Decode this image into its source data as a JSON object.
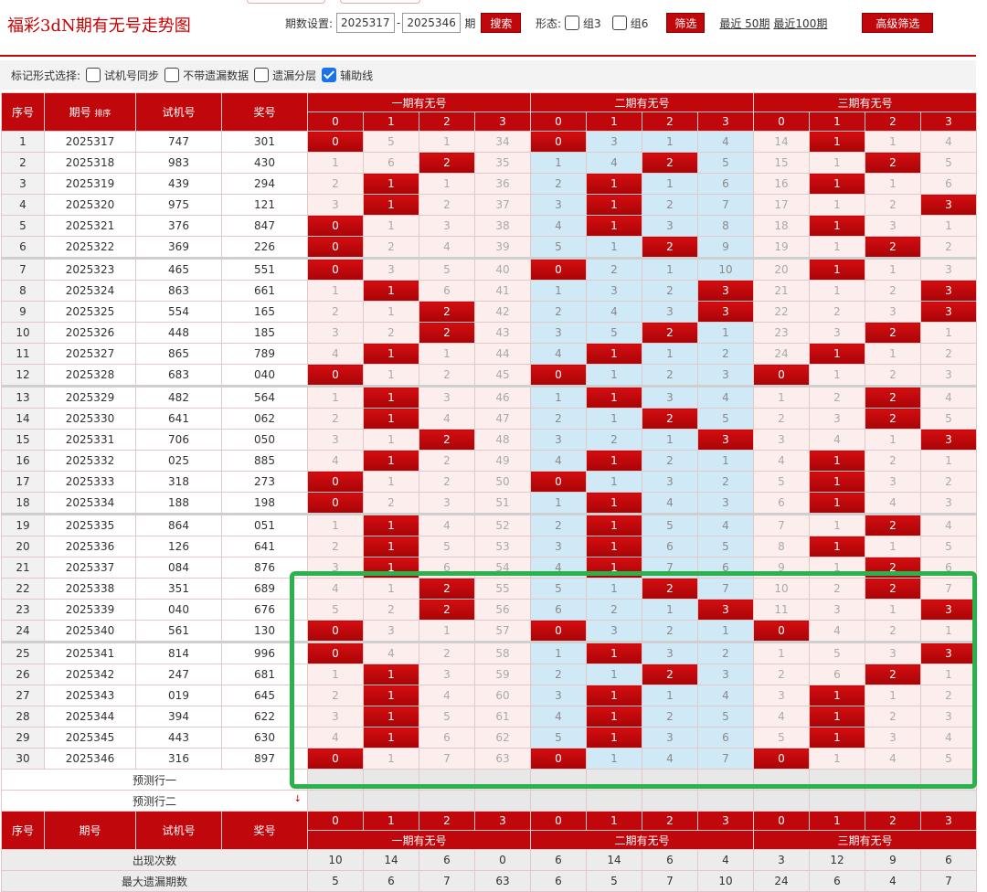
{
  "header": {
    "title": "福彩3dN期有无号走势图",
    "period_label": "期数设置:",
    "period_from": "2025317",
    "period_dash": "-",
    "period_to": "2025346",
    "period_unit": "期",
    "search": "搜索",
    "form_label": "形态:",
    "group3": "组3",
    "group6": "组6",
    "filter": "筛选",
    "recent50": "最近 50期",
    "recent100": "最近100期",
    "advanced": "高级筛选"
  },
  "options": {
    "label": "标记形式选择:",
    "items": [
      {
        "label": "试机号同步",
        "checked": false
      },
      {
        "label": "不带遗漏数据",
        "checked": false
      },
      {
        "label": "遗漏分层",
        "checked": false
      },
      {
        "label": "辅助线",
        "checked": true
      }
    ]
  },
  "table": {
    "head": {
      "seq": "序号",
      "issue": "期号",
      "sort": "排序",
      "test": "试机号",
      "prize": "奖号",
      "groups": [
        "一期有无号",
        "二期有无号",
        "三期有无号"
      ],
      "digits": [
        "0",
        "1",
        "2",
        "3"
      ]
    },
    "rows": [
      {
        "seq": "1",
        "issue": "2025317",
        "test": "747",
        "prize": "301",
        "g1": [
          "0",
          "5",
          "1",
          "34"
        ],
        "g2": [
          "0",
          "3",
          "1",
          "4"
        ],
        "g3": [
          "14",
          "1",
          "1",
          "4"
        ],
        "h1": 0,
        "h2": 0,
        "h3": 1
      },
      {
        "seq": "2",
        "issue": "2025318",
        "test": "983",
        "prize": "430",
        "g1": [
          "1",
          "6",
          "2",
          "35"
        ],
        "g2": [
          "1",
          "4",
          "2",
          "5"
        ],
        "g3": [
          "15",
          "1",
          "2",
          "5"
        ],
        "h1": 2,
        "h2": 2,
        "h3": 2
      },
      {
        "seq": "3",
        "issue": "2025319",
        "test": "439",
        "prize": "294",
        "g1": [
          "2",
          "1",
          "1",
          "36"
        ],
        "g2": [
          "2",
          "1",
          "1",
          "6"
        ],
        "g3": [
          "16",
          "1",
          "1",
          "6"
        ],
        "h1": 1,
        "h2": 1,
        "h3": 1
      },
      {
        "seq": "4",
        "issue": "2025320",
        "test": "975",
        "prize": "121",
        "g1": [
          "3",
          "1",
          "2",
          "37"
        ],
        "g2": [
          "3",
          "1",
          "2",
          "7"
        ],
        "g3": [
          "17",
          "1",
          "2",
          "3"
        ],
        "h1": 1,
        "h2": 1,
        "h3": 3
      },
      {
        "seq": "5",
        "issue": "2025321",
        "test": "376",
        "prize": "847",
        "g1": [
          "0",
          "1",
          "3",
          "38"
        ],
        "g2": [
          "4",
          "1",
          "3",
          "8"
        ],
        "g3": [
          "18",
          "1",
          "3",
          "1"
        ],
        "h1": 0,
        "h2": 1,
        "h3": 1
      },
      {
        "seq": "6",
        "issue": "2025322",
        "test": "369",
        "prize": "226",
        "g1": [
          "0",
          "2",
          "4",
          "39"
        ],
        "g2": [
          "5",
          "1",
          "2",
          "9"
        ],
        "g3": [
          "19",
          "1",
          "2",
          "2"
        ],
        "h1": 0,
        "h2": 2,
        "h3": 2
      },
      {
        "seq": "7",
        "issue": "2025323",
        "test": "465",
        "prize": "551",
        "g1": [
          "0",
          "3",
          "5",
          "40"
        ],
        "g2": [
          "0",
          "2",
          "1",
          "10"
        ],
        "g3": [
          "20",
          "1",
          "1",
          "3"
        ],
        "h1": 0,
        "h2": 0,
        "h3": 1
      },
      {
        "seq": "8",
        "issue": "2025324",
        "test": "863",
        "prize": "661",
        "g1": [
          "1",
          "1",
          "6",
          "41"
        ],
        "g2": [
          "1",
          "3",
          "2",
          "3"
        ],
        "g3": [
          "21",
          "1",
          "2",
          "3"
        ],
        "h1": 1,
        "h2": 3,
        "h3": 3
      },
      {
        "seq": "9",
        "issue": "2025325",
        "test": "554",
        "prize": "165",
        "g1": [
          "2",
          "1",
          "2",
          "42"
        ],
        "g2": [
          "2",
          "4",
          "3",
          "3"
        ],
        "g3": [
          "22",
          "2",
          "3",
          "3"
        ],
        "h1": 2,
        "h2": 3,
        "h3": 3
      },
      {
        "seq": "10",
        "issue": "2025326",
        "test": "448",
        "prize": "185",
        "g1": [
          "3",
          "2",
          "2",
          "43"
        ],
        "g2": [
          "3",
          "5",
          "2",
          "1"
        ],
        "g3": [
          "23",
          "3",
          "2",
          "1"
        ],
        "h1": 2,
        "h2": 2,
        "h3": 2
      },
      {
        "seq": "11",
        "issue": "2025327",
        "test": "865",
        "prize": "789",
        "g1": [
          "4",
          "1",
          "1",
          "44"
        ],
        "g2": [
          "4",
          "1",
          "1",
          "2"
        ],
        "g3": [
          "24",
          "1",
          "1",
          "2"
        ],
        "h1": 1,
        "h2": 1,
        "h3": 1
      },
      {
        "seq": "12",
        "issue": "2025328",
        "test": "683",
        "prize": "040",
        "g1": [
          "0",
          "1",
          "2",
          "45"
        ],
        "g2": [
          "0",
          "1",
          "2",
          "3"
        ],
        "g3": [
          "0",
          "1",
          "2",
          "3"
        ],
        "h1": 0,
        "h2": 0,
        "h3": 0
      },
      {
        "seq": "13",
        "issue": "2025329",
        "test": "482",
        "prize": "564",
        "g1": [
          "1",
          "1",
          "3",
          "46"
        ],
        "g2": [
          "1",
          "1",
          "3",
          "4"
        ],
        "g3": [
          "1",
          "2",
          "2",
          "4"
        ],
        "h1": 1,
        "h2": 1,
        "h3": 2
      },
      {
        "seq": "14",
        "issue": "2025330",
        "test": "641",
        "prize": "062",
        "g1": [
          "2",
          "1",
          "4",
          "47"
        ],
        "g2": [
          "2",
          "1",
          "2",
          "5"
        ],
        "g3": [
          "2",
          "3",
          "2",
          "5"
        ],
        "h1": 1,
        "h2": 2,
        "h3": 2
      },
      {
        "seq": "15",
        "issue": "2025331",
        "test": "706",
        "prize": "050",
        "g1": [
          "3",
          "1",
          "2",
          "48"
        ],
        "g2": [
          "3",
          "2",
          "1",
          "3"
        ],
        "g3": [
          "3",
          "4",
          "1",
          "3"
        ],
        "h1": 2,
        "h2": 3,
        "h3": 3
      },
      {
        "seq": "16",
        "issue": "2025332",
        "test": "025",
        "prize": "885",
        "g1": [
          "4",
          "1",
          "2",
          "49"
        ],
        "g2": [
          "4",
          "1",
          "2",
          "1"
        ],
        "g3": [
          "4",
          "1",
          "2",
          "1"
        ],
        "h1": 1,
        "h2": 1,
        "h3": 1
      },
      {
        "seq": "17",
        "issue": "2025333",
        "test": "318",
        "prize": "273",
        "g1": [
          "0",
          "1",
          "2",
          "50"
        ],
        "g2": [
          "0",
          "1",
          "3",
          "2"
        ],
        "g3": [
          "5",
          "1",
          "3",
          "2"
        ],
        "h1": 0,
        "h2": 0,
        "h3": 1
      },
      {
        "seq": "18",
        "issue": "2025334",
        "test": "188",
        "prize": "198",
        "g1": [
          "0",
          "2",
          "3",
          "51"
        ],
        "g2": [
          "1",
          "1",
          "4",
          "3"
        ],
        "g3": [
          "6",
          "1",
          "4",
          "3"
        ],
        "h1": 0,
        "h2": 1,
        "h3": 1
      },
      {
        "seq": "19",
        "issue": "2025335",
        "test": "864",
        "prize": "051",
        "g1": [
          "1",
          "1",
          "4",
          "52"
        ],
        "g2": [
          "2",
          "1",
          "5",
          "4"
        ],
        "g3": [
          "7",
          "1",
          "2",
          "4"
        ],
        "h1": 1,
        "h2": 1,
        "h3": 2
      },
      {
        "seq": "20",
        "issue": "2025336",
        "test": "126",
        "prize": "641",
        "g1": [
          "2",
          "1",
          "5",
          "53"
        ],
        "g2": [
          "3",
          "1",
          "6",
          "5"
        ],
        "g3": [
          "8",
          "1",
          "1",
          "5"
        ],
        "h1": 1,
        "h2": 1,
        "h3": 1
      },
      {
        "seq": "21",
        "issue": "2025337",
        "test": "084",
        "prize": "876",
        "g1": [
          "3",
          "1",
          "6",
          "54"
        ],
        "g2": [
          "4",
          "1",
          "7",
          "6"
        ],
        "g3": [
          "9",
          "1",
          "2",
          "6"
        ],
        "h1": 1,
        "h2": 1,
        "h3": 2
      },
      {
        "seq": "22",
        "issue": "2025338",
        "test": "351",
        "prize": "689",
        "g1": [
          "4",
          "1",
          "2",
          "55"
        ],
        "g2": [
          "5",
          "1",
          "2",
          "7"
        ],
        "g3": [
          "10",
          "2",
          "2",
          "7"
        ],
        "h1": 2,
        "h2": 2,
        "h3": 2
      },
      {
        "seq": "23",
        "issue": "2025339",
        "test": "040",
        "prize": "676",
        "g1": [
          "5",
          "2",
          "2",
          "56"
        ],
        "g2": [
          "6",
          "2",
          "1",
          "3"
        ],
        "g3": [
          "11",
          "3",
          "1",
          "3"
        ],
        "h1": 2,
        "h2": 3,
        "h3": 3
      },
      {
        "seq": "24",
        "issue": "2025340",
        "test": "561",
        "prize": "130",
        "g1": [
          "0",
          "3",
          "1",
          "57"
        ],
        "g2": [
          "0",
          "3",
          "2",
          "1"
        ],
        "g3": [
          "0",
          "4",
          "2",
          "1"
        ],
        "h1": 0,
        "h2": 0,
        "h3": 0
      },
      {
        "seq": "25",
        "issue": "2025341",
        "test": "814",
        "prize": "996",
        "g1": [
          "0",
          "4",
          "2",
          "58"
        ],
        "g2": [
          "1",
          "1",
          "3",
          "2"
        ],
        "g3": [
          "1",
          "5",
          "3",
          "3"
        ],
        "h1": 0,
        "h2": 1,
        "h3": 3
      },
      {
        "seq": "26",
        "issue": "2025342",
        "test": "247",
        "prize": "681",
        "g1": [
          "1",
          "1",
          "3",
          "59"
        ],
        "g2": [
          "2",
          "1",
          "2",
          "3"
        ],
        "g3": [
          "2",
          "6",
          "2",
          "1"
        ],
        "h1": 1,
        "h2": 2,
        "h3": 2
      },
      {
        "seq": "27",
        "issue": "2025343",
        "test": "019",
        "prize": "645",
        "g1": [
          "2",
          "1",
          "4",
          "60"
        ],
        "g2": [
          "3",
          "1",
          "1",
          "4"
        ],
        "g3": [
          "3",
          "1",
          "1",
          "2"
        ],
        "h1": 1,
        "h2": 1,
        "h3": 1
      },
      {
        "seq": "28",
        "issue": "2025344",
        "test": "394",
        "prize": "622",
        "g1": [
          "3",
          "1",
          "5",
          "61"
        ],
        "g2": [
          "4",
          "1",
          "2",
          "5"
        ],
        "g3": [
          "4",
          "1",
          "2",
          "3"
        ],
        "h1": 1,
        "h2": 1,
        "h3": 1
      },
      {
        "seq": "29",
        "issue": "2025345",
        "test": "443",
        "prize": "630",
        "g1": [
          "4",
          "1",
          "6",
          "62"
        ],
        "g2": [
          "5",
          "1",
          "3",
          "6"
        ],
        "g3": [
          "5",
          "1",
          "3",
          "4"
        ],
        "h1": 1,
        "h2": 1,
        "h3": 1
      },
      {
        "seq": "30",
        "issue": "2025346",
        "test": "316",
        "prize": "897",
        "g1": [
          "0",
          "1",
          "7",
          "63"
        ],
        "g2": [
          "0",
          "1",
          "4",
          "7"
        ],
        "g3": [
          "0",
          "1",
          "4",
          "5"
        ],
        "h1": 0,
        "h2": 0,
        "h3": 0
      }
    ],
    "predict": [
      "预测行一",
      "预测行二"
    ],
    "stats": [
      {
        "label": "出现次数",
        "values": [
          "10",
          "14",
          "6",
          "0",
          "6",
          "14",
          "6",
          "4",
          "3",
          "12",
          "9",
          "6"
        ]
      },
      {
        "label": "最大遗漏期数",
        "values": [
          "5",
          "6",
          "7",
          "63",
          "6",
          "5",
          "7",
          "10",
          "24",
          "6",
          "4",
          "7"
        ]
      }
    ]
  },
  "colors": {
    "accent": "#c0070b",
    "highlight_box": "#2bb24c",
    "blue_band": "#cfe9f7",
    "pink_band": "#fdeeee"
  }
}
